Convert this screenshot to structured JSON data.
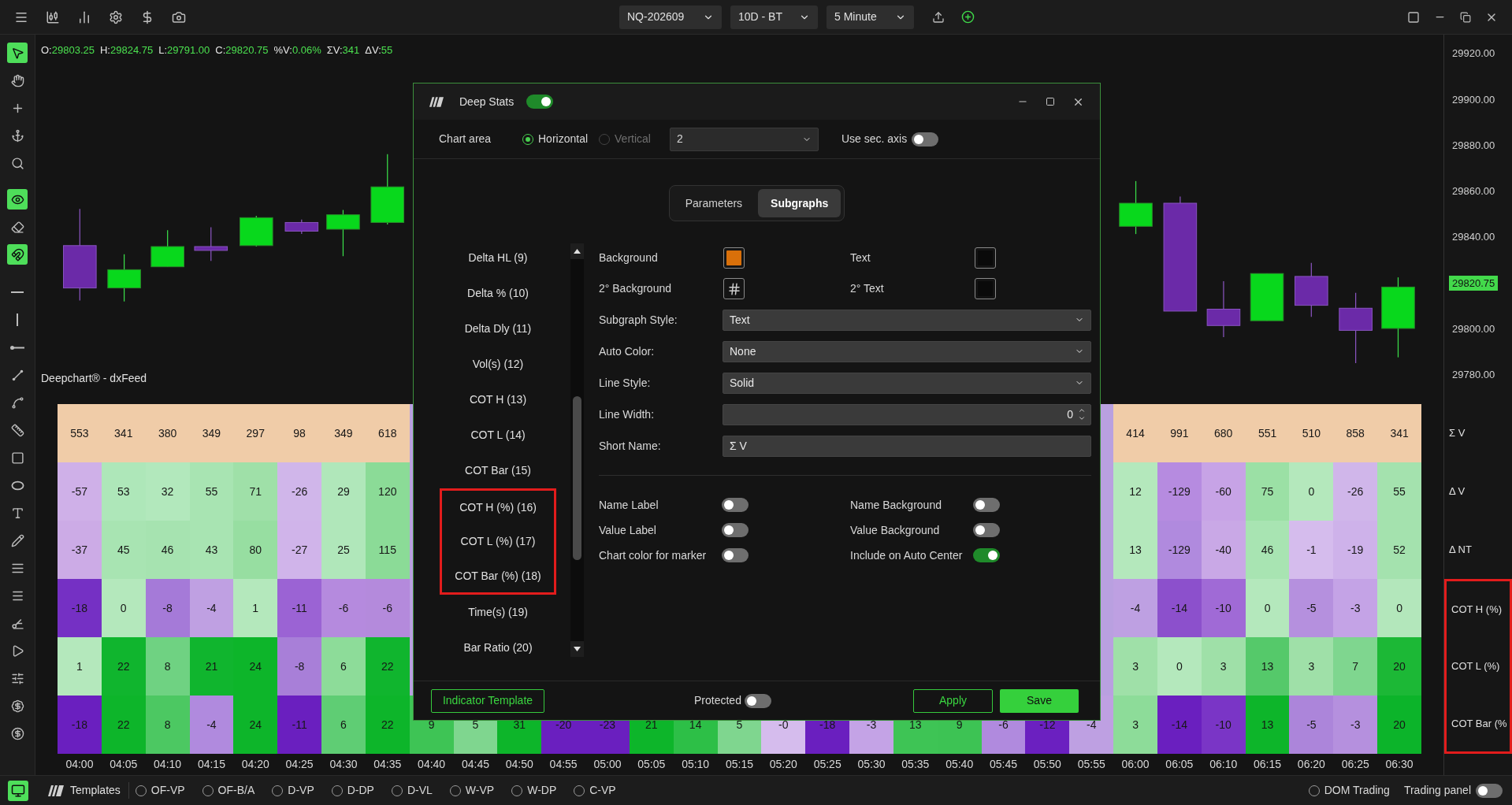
{
  "top_bar": {
    "selectors": [
      {
        "value": "NQ-202609"
      },
      {
        "value": "10D - BT"
      },
      {
        "value": "5 Minute"
      }
    ]
  },
  "left_tools": [
    {
      "kind": "pointer",
      "active": true
    },
    {
      "kind": "hand",
      "active": false
    },
    {
      "kind": "cross",
      "active": false
    },
    {
      "kind": "anchor",
      "active": false
    },
    {
      "kind": "zoom",
      "active": false
    },
    {
      "kind": "eye",
      "active": true
    },
    {
      "kind": "eraser",
      "active": false
    },
    {
      "kind": "magnet",
      "active": true
    },
    {
      "kind": "hline",
      "active": false
    },
    {
      "kind": "vline",
      "active": false
    },
    {
      "kind": "ray",
      "active": false
    },
    {
      "kind": "line",
      "active": false
    },
    {
      "kind": "path",
      "active": false
    },
    {
      "kind": "ruler",
      "active": false
    },
    {
      "kind": "rect",
      "active": false
    },
    {
      "kind": "ellipse",
      "active": false
    },
    {
      "kind": "text",
      "active": false
    },
    {
      "kind": "pencil",
      "active": false
    },
    {
      "kind": "lines",
      "active": false
    },
    {
      "kind": "list",
      "active": false
    },
    {
      "kind": "fib",
      "active": false
    },
    {
      "kind": "arrow",
      "active": false
    },
    {
      "kind": "sliders",
      "active": false
    },
    {
      "kind": "badge",
      "active": false
    },
    {
      "kind": "coin",
      "active": false
    }
  ],
  "ohlc": [
    {
      "label": "O:",
      "value": "29803.25"
    },
    {
      "label": "H:",
      "value": "29824.75"
    },
    {
      "label": "L:",
      "value": "29791.00"
    },
    {
      "label": "C:",
      "value": "29820.75"
    },
    {
      "label": "%V:",
      "value": "0.06%"
    },
    {
      "label": "ΣV:",
      "value": "341"
    },
    {
      "label": "ΔV:",
      "value": "55"
    }
  ],
  "chart_source": "Deepchart® - dxFeed",
  "price_axis": [
    {
      "label": "29920.00",
      "current": false
    },
    {
      "label": "29900.00",
      "current": false
    },
    {
      "label": "29880.00",
      "current": false
    },
    {
      "label": "29860.00",
      "current": false
    },
    {
      "label": "29840.00",
      "current": false
    },
    {
      "label": "29820.75",
      "current": true
    },
    {
      "label": "29800.00",
      "current": false
    },
    {
      "label": "29780.00",
      "current": false
    }
  ],
  "stats_table": {
    "rows": [
      {
        "label": "Σ V",
        "marked": false,
        "cells": [
          {
            "value": "553",
            "color": "#f0cca8"
          },
          {
            "value": "341",
            "color": "#f0cca8"
          },
          {
            "value": "380",
            "color": "#f0cca8"
          },
          {
            "value": "349",
            "color": "#f0cca8"
          },
          {
            "value": "297",
            "color": "#f0cca8"
          },
          {
            "value": "98",
            "color": "#f0cca8"
          },
          {
            "value": "349",
            "color": "#f0cca8"
          },
          {
            "value": "618",
            "color": "#f0cca8"
          },
          null,
          null,
          null,
          null,
          null,
          null,
          null,
          null,
          null,
          null,
          null,
          null,
          null,
          null,
          null,
          null,
          {
            "value": "414",
            "color": "#f0cca8"
          },
          {
            "value": "991",
            "color": "#f0cca8"
          },
          {
            "value": "680",
            "color": "#f0cca8"
          },
          {
            "value": "551",
            "color": "#f0cca8"
          },
          {
            "value": "510",
            "color": "#f0cca8"
          },
          {
            "value": "858",
            "color": "#f0cca8"
          },
          {
            "value": "341",
            "color": "#f0cca8"
          }
        ]
      },
      {
        "label": "Δ V",
        "marked": false,
        "cells": [
          {
            "value": "-57",
            "color": "#cfb0e8"
          },
          {
            "value": "53",
            "color": "#aee7b9"
          },
          {
            "value": "32",
            "color": "#b2e8bc"
          },
          {
            "value": "55",
            "color": "#a8e4b2"
          },
          {
            "value": "71",
            "color": "#9fe0a8"
          },
          {
            "value": "-26",
            "color": "#d0b6ea"
          },
          {
            "value": "29",
            "color": "#b0e7ba"
          },
          {
            "value": "120",
            "color": "#8bdb97"
          },
          null,
          null,
          null,
          null,
          null,
          null,
          null,
          null,
          null,
          null,
          null,
          null,
          null,
          null,
          null,
          null,
          {
            "value": "12",
            "color": "#b4e8bc"
          },
          {
            "value": "-129",
            "color": "#b68be0"
          },
          {
            "value": "-60",
            "color": "#c7a3e6"
          },
          {
            "value": "75",
            "color": "#9be0a5"
          },
          {
            "value": "0",
            "color": "#b4e8bc"
          },
          {
            "value": "-26",
            "color": "#d0b6ea"
          },
          {
            "value": "55",
            "color": "#a4e2ae"
          }
        ]
      },
      {
        "label": "Δ NT",
        "marked": false,
        "cells": [
          {
            "value": "-37",
            "color": "#ccabe6"
          },
          {
            "value": "45",
            "color": "#a8e4b2"
          },
          {
            "value": "46",
            "color": "#a6e3b0"
          },
          {
            "value": "43",
            "color": "#a8e4b2"
          },
          {
            "value": "80",
            "color": "#97dea1"
          },
          {
            "value": "-27",
            "color": "#d0b4ea"
          },
          {
            "value": "25",
            "color": "#b0e7ba"
          },
          {
            "value": "115",
            "color": "#8bdb97"
          },
          null,
          null,
          null,
          null,
          null,
          null,
          null,
          null,
          null,
          null,
          null,
          null,
          null,
          null,
          null,
          null,
          {
            "value": "13",
            "color": "#b4e8bc"
          },
          {
            "value": "-129",
            "color": "#b08ade"
          },
          {
            "value": "-40",
            "color": "#c9a8e6"
          },
          {
            "value": "46",
            "color": "#a8e4b2"
          },
          {
            "value": "-1",
            "color": "#d5bced"
          },
          {
            "value": "-19",
            "color": "#ceb2ea"
          },
          {
            "value": "52",
            "color": "#a4e2ae"
          }
        ]
      },
      {
        "label": "COT H (%)",
        "marked": true,
        "cells": [
          {
            "value": "-18",
            "color": "#7530c4"
          },
          {
            "value": "0",
            "color": "#b4e8bc"
          },
          {
            "value": "-8",
            "color": "#a57ad8"
          },
          {
            "value": "-4",
            "color": "#bfa0e2"
          },
          {
            "value": "1",
            "color": "#b4e8bc"
          },
          {
            "value": "-11",
            "color": "#9b63d4"
          },
          {
            "value": "-6",
            "color": "#b58ade"
          },
          {
            "value": "-6",
            "color": "#b48adc"
          },
          null,
          null,
          null,
          null,
          null,
          null,
          null,
          null,
          null,
          null,
          null,
          null,
          null,
          null,
          null,
          null,
          {
            "value": "-4",
            "color": "#bea0e2"
          },
          {
            "value": "-14",
            "color": "#8c50cc"
          },
          {
            "value": "-10",
            "color": "#a06ad6"
          },
          {
            "value": "0",
            "color": "#b4e8bc"
          },
          {
            "value": "-5",
            "color": "#b590de"
          },
          {
            "value": "-3",
            "color": "#c4a3e6"
          },
          {
            "value": "0",
            "color": "#b3e7bb"
          }
        ]
      },
      {
        "label": "COT L (%)",
        "marked": true,
        "cells": [
          {
            "value": "1",
            "color": "#b4e8bc"
          },
          {
            "value": "22",
            "color": "#10b52e"
          },
          {
            "value": "8",
            "color": "#6fd282"
          },
          {
            "value": "21",
            "color": "#10b52e"
          },
          {
            "value": "24",
            "color": "#0db52a"
          },
          {
            "value": "-8",
            "color": "#a87fd8"
          },
          {
            "value": "6",
            "color": "#8ddc99"
          },
          {
            "value": "22",
            "color": "#10b52e"
          },
          null,
          null,
          null,
          null,
          null,
          null,
          null,
          null,
          null,
          null,
          null,
          null,
          null,
          null,
          null,
          null,
          {
            "value": "3",
            "color": "#9fe0a8"
          },
          {
            "value": "0",
            "color": "#b4e8bc"
          },
          {
            "value": "3",
            "color": "#9fe0a8"
          },
          {
            "value": "13",
            "color": "#55c96a"
          },
          {
            "value": "3",
            "color": "#9fe0a8"
          },
          {
            "value": "7",
            "color": "#7fd68f"
          },
          {
            "value": "20",
            "color": "#1cb836"
          }
        ]
      },
      {
        "label": "COT Bar (%",
        "marked": true,
        "cells": [
          {
            "value": "-18",
            "color": "#6a1fbf"
          },
          {
            "value": "22",
            "color": "#0db52a"
          },
          {
            "value": "8",
            "color": "#4cc862"
          },
          {
            "value": "-4",
            "color": "#b08ade"
          },
          {
            "value": "24",
            "color": "#0db52a"
          },
          {
            "value": "-11",
            "color": "#6a1fbf"
          },
          {
            "value": "6",
            "color": "#5fcd74"
          },
          {
            "value": "22",
            "color": "#0db52a"
          },
          {
            "value": "9",
            "color": "#3ec455"
          },
          {
            "value": "5",
            "color": "#7fd68f"
          },
          {
            "value": "31",
            "color": "#0db52a"
          },
          {
            "value": "-20",
            "color": "#6a1fbf"
          },
          {
            "value": "-23",
            "color": "#6a1fbf"
          },
          {
            "value": "21",
            "color": "#0db52a"
          },
          {
            "value": "14",
            "color": "#2dbf47"
          },
          {
            "value": "5",
            "color": "#7fd68f"
          },
          {
            "value": "-0",
            "color": "#d5bced"
          },
          {
            "value": "-18",
            "color": "#6a1fbf"
          },
          {
            "value": "-3",
            "color": "#c4a3e6"
          },
          {
            "value": "13",
            "color": "#3ec455"
          },
          {
            "value": "9",
            "color": "#3dc354"
          },
          {
            "value": "-6",
            "color": "#b08ade"
          },
          {
            "value": "-12",
            "color": "#6b20c0"
          },
          {
            "value": "-4",
            "color": "#bea0e2"
          },
          {
            "value": "3",
            "color": "#8ddc99"
          },
          {
            "value": "-14",
            "color": "#6a1fbf"
          },
          {
            "value": "-10",
            "color": "#7a35c6"
          },
          {
            "value": "13",
            "color": "#0db52a"
          },
          {
            "value": "-5",
            "color": "#ac85da"
          },
          {
            "value": "-3",
            "color": "#b590de"
          },
          {
            "value": "20",
            "color": "#0cb42a"
          }
        ]
      }
    ],
    "times": [
      "04:00",
      "04:05",
      "04:10",
      "04:15",
      "04:20",
      "04:25",
      "04:30",
      "04:35",
      "04:40",
      "04:45",
      "04:50",
      "04:55",
      "05:00",
      "05:05",
      "05:10",
      "05:15",
      "05:20",
      "05:25",
      "05:30",
      "05:35",
      "05:40",
      "05:45",
      "05:50",
      "05:55",
      "06:00",
      "06:05",
      "06:10",
      "06:15",
      "06:20",
      "06:25",
      "06:30"
    ]
  },
  "dialog": {
    "title": "Deep Stats",
    "enabled": true,
    "chart_area": {
      "label": "Chart area",
      "options": [
        {
          "label": "Horizontal",
          "selected": true,
          "disabled": false
        },
        {
          "label": "Vertical",
          "selected": false,
          "disabled": true
        }
      ],
      "area": "2",
      "sec_axis": {
        "label": "Use sec. axis",
        "on": false
      }
    },
    "tabs": [
      {
        "label": "Parameters",
        "selected": false
      },
      {
        "label": "Subgraphs",
        "selected": true
      }
    ],
    "subgraphs": [
      {
        "label": "Delta HL (9)",
        "marked": false
      },
      {
        "label": "Delta % (10)",
        "marked": false
      },
      {
        "label": "Delta Dly (11)",
        "marked": false
      },
      {
        "label": "Vol(s) (12)",
        "marked": false
      },
      {
        "label": "COT H (13)",
        "marked": false
      },
      {
        "label": "COT L (14)",
        "marked": false
      },
      {
        "label": "COT Bar (15)",
        "marked": false
      },
      {
        "label": "COT H (%) (16)",
        "marked": true
      },
      {
        "label": "COT L (%) (17)",
        "marked": true
      },
      {
        "label": "COT Bar (%) (18)",
        "marked": true
      },
      {
        "label": "Time(s) (19)",
        "marked": false
      },
      {
        "label": "Bar Ratio (20)",
        "marked": false
      }
    ],
    "colors": [
      {
        "label": "Background",
        "kind": "swatch",
        "color": "#d9700a"
      },
      {
        "label": "Text",
        "kind": "swatch",
        "color": "#0a0a0a"
      },
      {
        "label": "2° Background",
        "kind": "pattern"
      },
      {
        "label": "2° Text",
        "kind": "swatch",
        "color": "#0a0a0a"
      }
    ],
    "fields": [
      {
        "label": "Subgraph Style:",
        "kind": "select",
        "value": "Text"
      },
      {
        "label": "Auto Color:",
        "kind": "select",
        "value": "None"
      },
      {
        "label": "Line Style:",
        "kind": "select",
        "value": "Solid"
      },
      {
        "label": "Line Width:",
        "kind": "spinner",
        "value": "0"
      },
      {
        "label": "Short Name:",
        "kind": "text",
        "value": "Σ V"
      }
    ],
    "toggles": [
      {
        "label": "Name Label",
        "on": false
      },
      {
        "label": "Name Background",
        "on": false
      },
      {
        "label": "Value Label",
        "on": false
      },
      {
        "label": "Value Background",
        "on": false
      },
      {
        "label": "Chart color for marker",
        "on": false
      },
      {
        "label": "Include on Auto Center",
        "on": true
      }
    ],
    "footer": {
      "template_button": "Indicator Template",
      "protected": {
        "label": "Protected",
        "on": false
      },
      "apply": "Apply",
      "save": "Save"
    }
  },
  "bottom_bar": {
    "screen_active": true,
    "templates_label": "Templates",
    "templates": [
      {
        "label": "OF-VP",
        "selected": false
      },
      {
        "label": "OF-B/A",
        "selected": false
      },
      {
        "label": "D-VP",
        "selected": false
      },
      {
        "label": "D-DP",
        "selected": false
      },
      {
        "label": "D-VL",
        "selected": false
      },
      {
        "label": "W-VP",
        "selected": false
      },
      {
        "label": "W-DP",
        "selected": false
      },
      {
        "label": "C-VP",
        "selected": false
      }
    ],
    "dom_trading": {
      "label": "DOM Trading",
      "selected": false
    },
    "trading_panel": {
      "label": "Trading panel",
      "on": false
    }
  }
}
